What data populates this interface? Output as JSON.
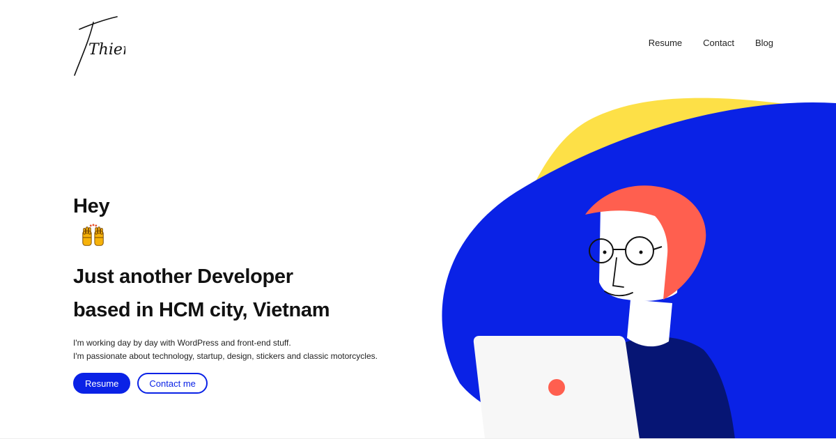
{
  "logo": {
    "text": "Thien"
  },
  "nav": {
    "items": [
      {
        "label": "Resume"
      },
      {
        "label": "Contact"
      },
      {
        "label": "Blog"
      }
    ]
  },
  "hero": {
    "greeting": "Hey",
    "greeting_icon": "raising-hands-icon",
    "line2": "Just another Developer",
    "line3": "based in HCM city, Vietnam",
    "desc_line1": "I'm working day by day with WordPress and front-end stuff.",
    "desc_line2": "I'm passionate about technology, startup, design, stickers and classic motorcycles.",
    "primary_button": "Resume",
    "secondary_button": "Contact me"
  },
  "illustration": {
    "subject": "developer-with-laptop-illustration",
    "colors": {
      "blob_blue": "#0a22e6",
      "blob_yellow": "#fde047",
      "hair": "#ff5f4f",
      "shirt": "#061574",
      "laptop": "#f7f7f7",
      "laptop_dot": "#ff5f4f"
    }
  },
  "colors": {
    "accent": "#0a22e6",
    "text": "#111111",
    "background": "#ffffff"
  }
}
